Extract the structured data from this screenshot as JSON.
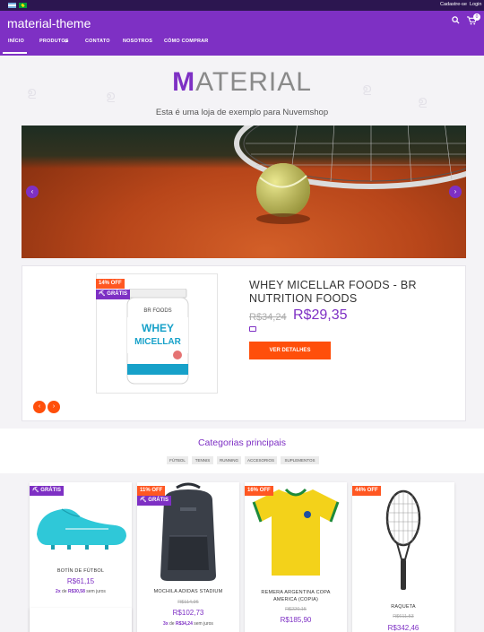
{
  "topbar": {
    "register": "Cadastre-se",
    "login": "Login"
  },
  "header": {
    "brand": "material-theme",
    "cart_count": "0"
  },
  "nav": [
    {
      "label": "INÍCIO"
    },
    {
      "label": "PRODUTOS"
    },
    {
      "label": "CONTATO"
    },
    {
      "label": "NOSOTROS"
    },
    {
      "label": "CÓMO COMPRAR"
    }
  ],
  "hero": {
    "logo_first": "M",
    "logo_rest": "ATERIAL",
    "tagline": "Esta é uma loja de exemplo para Nuvemshop"
  },
  "featured": {
    "badge_off": "14% OFF",
    "badge_free": "GRÁTIS",
    "title": "WHEY MICELLAR FOODS - BR NUTRITION FOODS",
    "old_price": "R$34,24",
    "price": "R$29,35",
    "button": "VER DETALHES",
    "image_brand": "BR FOODS",
    "image_label_1": "WHEY",
    "image_label_2": "MICELLAR"
  },
  "categories": {
    "title": "Categorias principais",
    "chips": [
      "FÚTBOL",
      "TENNIS",
      "RUNNING",
      "ACCESORIOS",
      "SUPLEMENTOS"
    ]
  },
  "products": [
    {
      "badge_free": "GRÁTIS",
      "name": "BOTÍN DE FÚTBOL",
      "price": "R$61,15",
      "inst_count": "2x",
      "inst_word": "de",
      "inst_value": "R$30,58",
      "inst_suffix": "sem juros"
    },
    {
      "badge_off": "11% OFF",
      "badge_free": "GRÁTIS",
      "name": "MOCHILA ADIDAS STADIUM",
      "old_price": "R$114,96",
      "price": "R$102,73",
      "inst_count": "3x",
      "inst_word": "de",
      "inst_value": "R$34,24",
      "inst_suffix": "sem juros"
    },
    {
      "badge_off": "16% OFF",
      "name": "REMERA ARGENTINA COPA AMERICA (COPIA)",
      "old_price": "R$220,15",
      "price": "R$185,90"
    },
    {
      "badge_off": "44% OFF",
      "name": "RAQUETA",
      "old_price": "R$611,53",
      "price": "R$342,46"
    }
  ],
  "colors": {
    "primary": "#7e30c4",
    "accent": "#ff4f0b",
    "topbar": "#2c1650"
  }
}
